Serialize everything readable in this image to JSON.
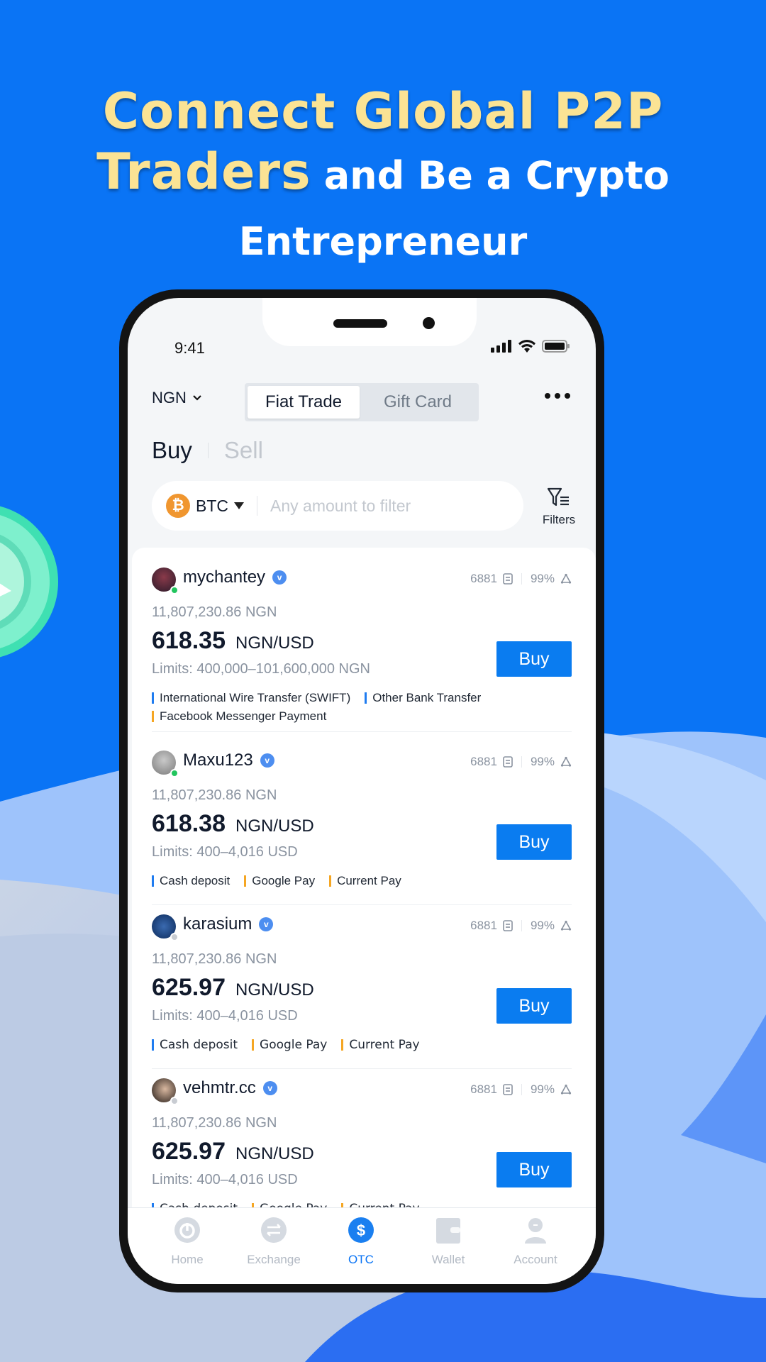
{
  "headline": {
    "line1": "Connect Global P2P",
    "line2_highlight": "Traders",
    "line2_rest": "and Be a Crypto",
    "line3": "Entrepreneur"
  },
  "status_bar": {
    "time": "9:41"
  },
  "topbar": {
    "currency": "NGN",
    "tabs": [
      {
        "label": "Fiat Trade",
        "active": true
      },
      {
        "label": "Gift Card",
        "active": false
      }
    ],
    "more_icon": "more-dots-icon"
  },
  "mode": {
    "buy": "Buy",
    "sell": "Sell",
    "active": "Buy"
  },
  "filter_bar": {
    "coin": "BTC",
    "coin_icon": "bitcoin-icon",
    "amount_placeholder": "Any amount to filter",
    "amount_value": "",
    "filters_label": "Filters"
  },
  "offers": [
    {
      "username": "mychantey",
      "verified": true,
      "online": true,
      "orders": "6881",
      "completion": "99%",
      "volume": "11,807,230.86 NGN",
      "price": "618.35",
      "pair": "NGN/USD",
      "limits": "Limits:  400,000–101,600,000 NGN",
      "button": "Buy",
      "methods": [
        {
          "label": "International Wire Transfer (SWIFT)",
          "color": "#1f7cf0"
        },
        {
          "label": "Other Bank Transfer",
          "color": "#1f7cf0"
        },
        {
          "label": "Facebook Messenger Payment",
          "color": "#f5a623"
        }
      ]
    },
    {
      "username": "Maxu123",
      "verified": true,
      "online": true,
      "orders": "6881",
      "completion": "99%",
      "volume": "11,807,230.86 NGN",
      "price": "618.38",
      "pair": "NGN/USD",
      "limits": "Limits: 400–4,016 USD",
      "button": "Buy",
      "methods": [
        {
          "label": "Cash deposit",
          "color": "#1f7cf0"
        },
        {
          "label": "Google Pay",
          "color": "#f5a623"
        },
        {
          "label": "Current Pay",
          "color": "#f5a623"
        }
      ]
    },
    {
      "username": "karasium",
      "verified": true,
      "online": false,
      "orders": "6881",
      "completion": "99%",
      "volume": "11,807,230.86 NGN",
      "price": "625.97",
      "pair": "NGN/USD",
      "limits": "Limits: 400–4,016 USD",
      "button": "Buy",
      "methods": [
        {
          "label": "Cash deposit",
          "color": "#1f7cf0"
        },
        {
          "label": "Google Pay",
          "color": "#f5a623"
        },
        {
          "label": "Current Pay",
          "color": "#f5a623"
        }
      ]
    },
    {
      "username": "vehmtr.cc",
      "verified": true,
      "online": false,
      "orders": "6881",
      "completion": "99%",
      "volume": "11,807,230.86 NGN",
      "price": "625.97",
      "pair": "NGN/USD",
      "limits": "Limits: 400–4,016 USD",
      "button": "Buy",
      "methods": [
        {
          "label": "Cash deposit",
          "color": "#1f7cf0"
        },
        {
          "label": "Google Pay",
          "color": "#f5a623"
        },
        {
          "label": "Current Pay",
          "color": "#f5a623"
        }
      ]
    }
  ],
  "tabbar": [
    {
      "label": "Home",
      "icon": "home-icon",
      "active": false
    },
    {
      "label": "Exchange",
      "icon": "exchange-icon",
      "active": false
    },
    {
      "label": "OTC",
      "icon": "otc-dollar-icon",
      "active": true
    },
    {
      "label": "Wallet",
      "icon": "wallet-icon",
      "active": false
    },
    {
      "label": "Account",
      "icon": "account-icon",
      "active": false
    }
  ],
  "colors": {
    "background": "#0a74f5",
    "headline_highlight": "#fbe394",
    "accent": "#0a7cf0",
    "online": "#22c55e",
    "offline": "#c8ccd2"
  }
}
